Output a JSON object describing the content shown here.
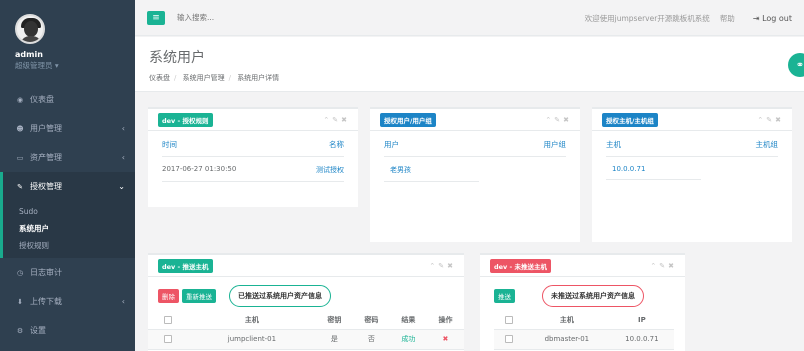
{
  "sidebar": {
    "username": "admin",
    "role": "超级管理员 ▾",
    "items": [
      {
        "icon": "dashboard-icon",
        "glyph": "◉",
        "label": "仪表盘"
      },
      {
        "icon": "users-icon",
        "glyph": "☻",
        "label": "用户管理"
      },
      {
        "icon": "assets-icon",
        "glyph": "▭",
        "label": "资产管理"
      },
      {
        "icon": "edit-icon",
        "glyph": "✎",
        "label": "授权管理"
      },
      {
        "icon": "history-icon",
        "glyph": "◷",
        "label": "日志审计"
      },
      {
        "icon": "download-icon",
        "glyph": "⬇",
        "label": "上传下载"
      },
      {
        "icon": "gears-icon",
        "glyph": "⚙",
        "label": "设置"
      }
    ],
    "sub_items": [
      "Sudo",
      "系统用户",
      "授权规则"
    ]
  },
  "topbar": {
    "search_placeholder": "输入搜索...",
    "welcome": "欢迎使用jumpserver开源跳板机系统",
    "help": "帮助",
    "logout": "Log out"
  },
  "heading": {
    "title": "系统用户",
    "crumbs": [
      "仪表盘",
      "系统用户管理",
      "系统用户详情"
    ]
  },
  "panels": {
    "rule": {
      "label": "dev - 授权规则",
      "col1": "时间",
      "col2": "名称",
      "time": "2017-06-27 01:30:50",
      "name": "测试授权"
    },
    "users": {
      "label": "授权用户/用户组",
      "col1": "用户",
      "col2": "用户组",
      "user": "老男孩"
    },
    "hosts": {
      "label": "授权主机/主机组",
      "col1": "主机",
      "col2": "主机组",
      "host": "10.0.0.71"
    },
    "pushed": {
      "label": "dev - 推送主机",
      "btn_delete": "删除",
      "btn_repush": "重新推送",
      "note": "已推送过系统用户资产信息",
      "headers": [
        "主机",
        "密钥",
        "密码",
        "结果",
        "操作"
      ],
      "row": {
        "host": "jumpclient-01",
        "key": "是",
        "password": "否",
        "result": "成功",
        "action": "✖"
      }
    },
    "unpushed": {
      "label": "dev - 未推送主机",
      "btn_push": "推送",
      "note": "未推送过系统用户资产信息",
      "headers": [
        "主机",
        "IP"
      ],
      "row": {
        "host": "dbmaster-01",
        "ip": "10.0.0.71"
      }
    }
  },
  "colors": {
    "accent": "#1ab394",
    "link": "#1c84c6",
    "danger": "#ed5565",
    "sidebar": "#2f4050"
  }
}
